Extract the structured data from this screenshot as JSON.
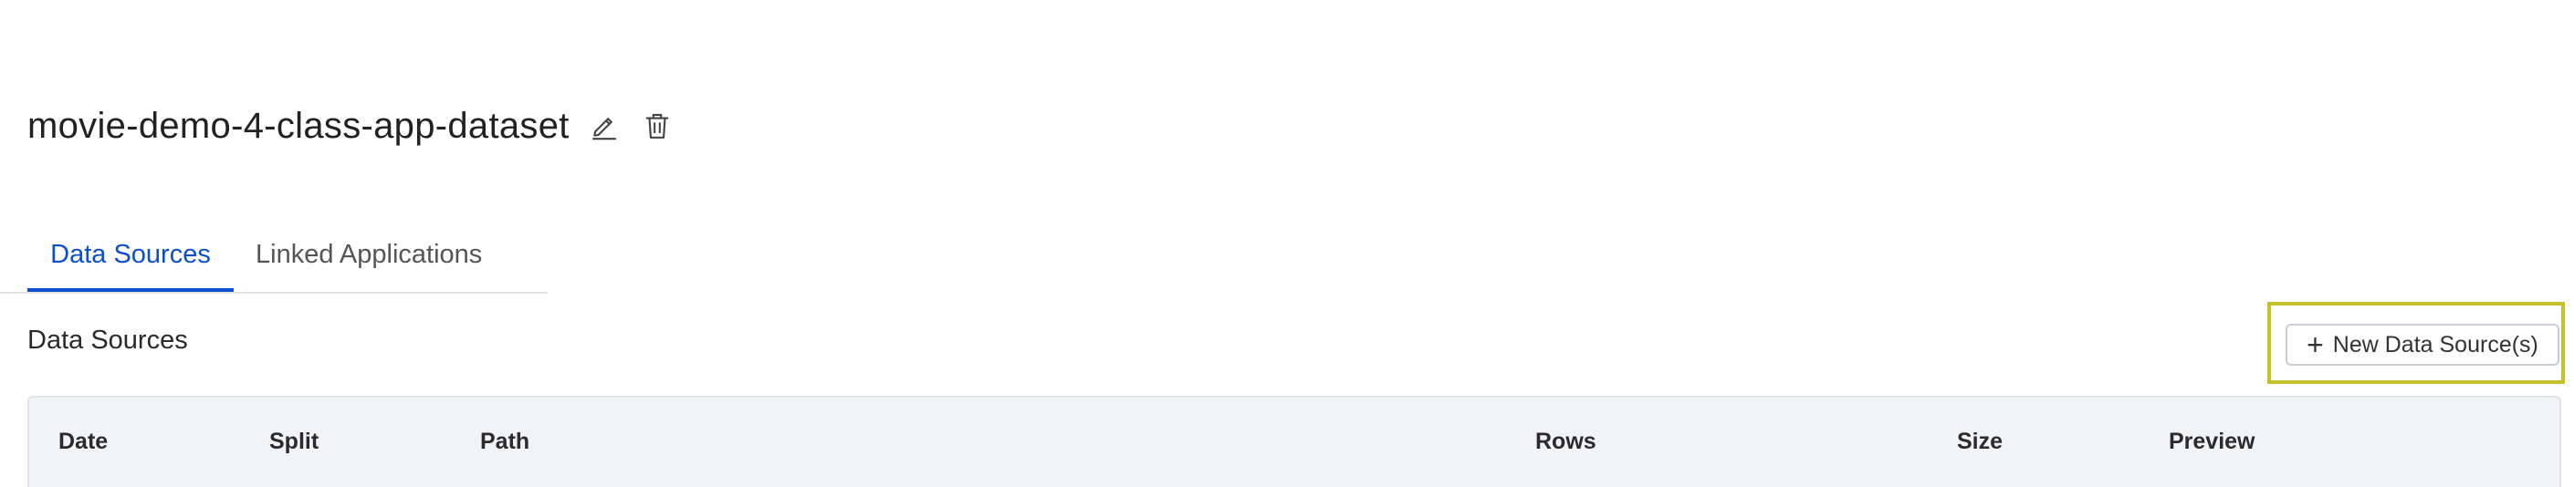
{
  "header": {
    "title": "movie-demo-4-class-app-dataset",
    "edit_icon": "pencil-edit-icon",
    "delete_icon": "trash-icon"
  },
  "tabs": [
    {
      "label": "Data Sources",
      "active": true
    },
    {
      "label": "Linked Applications",
      "active": false
    }
  ],
  "section": {
    "title": "Data Sources",
    "new_button_label": "New Data Source(s)",
    "new_button_icon": "plus-icon"
  },
  "table": {
    "columns": [
      "Date",
      "Split",
      "Path",
      "Rows",
      "Size",
      "Preview"
    ]
  },
  "colors": {
    "accent": "#0b4fcf",
    "highlight": "#c7c02c",
    "table_header_bg": "#f2f3f7"
  }
}
